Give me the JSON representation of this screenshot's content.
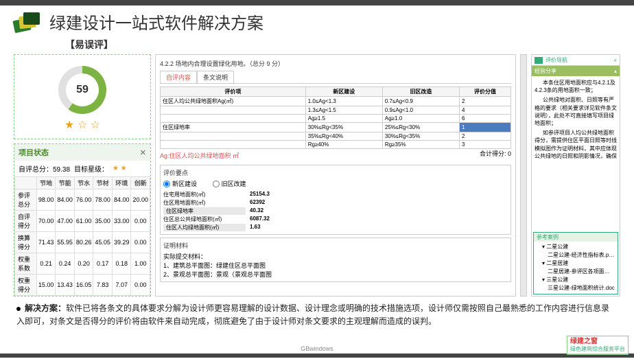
{
  "header": {
    "title": "绿建设计一站式软件解决方案",
    "sub": "【易误评】"
  },
  "score": {
    "value": "59",
    "stars": "★ ☆ ☆"
  },
  "status": {
    "title": "项目状态",
    "close": "✕",
    "self_total": "自评总分：59.38",
    "target_label": "目标星级：",
    "target_stars": "★ ★",
    "cols": [
      "节地",
      "节能",
      "节水",
      "节材",
      "环境",
      "创新"
    ],
    "rows": [
      {
        "n": "参评总分",
        "v": [
          "98.00",
          "84.00",
          "76.00",
          "78.00",
          "84.00",
          "20.00"
        ]
      },
      {
        "n": "自评得分",
        "v": [
          "70.00",
          "47.00",
          "61.00",
          "35.00",
          "33.00",
          "0.00"
        ]
      },
      {
        "n": "换算得分",
        "v": [
          "71.43",
          "55.95",
          "80.26",
          "45.05",
          "39.29",
          "0.00"
        ]
      },
      {
        "n": "权重系数",
        "v": [
          "0.21",
          "0.24",
          "0.20",
          "0.17",
          "0.18",
          "1.00"
        ]
      },
      {
        "n": "权重得分",
        "v": [
          "15.00",
          "13.43",
          "16.05",
          "7.83",
          "7.07",
          "0.00"
        ]
      }
    ]
  },
  "mid": {
    "clause": "4.2.2 场地内合理设置绿化用地。（总分 9 分）",
    "tab1": "自评内容",
    "tab2": "条文说明",
    "th": [
      "评价项",
      "新区建设",
      "旧区改造",
      "评价分值"
    ],
    "rows": [
      [
        "住区人均公共绿地面积Ag(㎡)",
        "1.0≤Ag<1.3",
        "0.7≤Ag<0.9",
        "2"
      ],
      [
        "",
        "1.3≤Ag<1.5",
        "0.9≤Ag<1.0",
        "4"
      ],
      [
        "",
        "Ag≥1.5",
        "Ag≥1.0",
        "6"
      ],
      [
        "住区绿地率",
        "30%≤Rg<35%",
        "25%≤Rg<30%",
        "1"
      ],
      [
        "",
        "35%≤Rg<40%",
        "30%≤Rg<35%",
        "2"
      ],
      [
        "",
        "Rg≥40%",
        "Rg≥35%",
        "3"
      ]
    ],
    "note": "Ag:住区人均公共绿地面积 ㎡",
    "total_label": "合计得分:",
    "total": "0",
    "sec1": "评价要点",
    "opt1": "新区建设",
    "opt2": "旧区改建",
    "gk": [
      "住宅用地面积(㎡)",
      "住区用地面积(㎡)",
      "住区绿地率",
      "住区总公共绿地面积(㎡)",
      "住区人均绿地面积(㎡)"
    ],
    "gv": [
      "25154.3",
      "62392",
      "40.32",
      "6087.32",
      "1.63"
    ],
    "sec2": "证明材料",
    "m1": "实际提交材料：",
    "m2": "1、建筑总平面图：绿建住区总平面图",
    "m3": "2、景观总平面图：景观（景观总平面图"
  },
  "right": {
    "nav": "评价导航",
    "exp": "经验分享",
    "p1": "本条住区用地面积应与4.2.1及4.2.3条的用地面积一致；",
    "p2": "公共绿地对面积、日照等有严格的要求（相关要求详见软件条文说明），此处不可直接填写项目绿地面积；",
    "p3": "如参评项目人均公共绿地面积得分，需提供住区平面日照等时线模拟图作为证明材料，其中应体现公共绿地的日照和阴影情况，确保",
    "ref": "参考案例",
    "t1": "二星公建",
    "f1": "二星公建-经济性指标表.png",
    "t2": "二星居建",
    "f2": "二星居建-参评区各项面积指标",
    "t3": "三星公建",
    "f3": "三星公建-绿地面积统计.doc"
  },
  "desc": {
    "label": "解决方案：",
    "text": "软件已将各条文的具体要求分解为设计师更容易理解的设计数据、设计理念或明确的技术措施选项，设计师仅需按照自己最熟悉的工作内容进行信息录入即可，对条文是否得分的评价将由软件来自动完成，彻底避免了由于设计师对条文要求的主观理解而造成的误判。"
  },
  "footer": {
    "brand": "GBwindows",
    "stamp1": "绿建之窗",
    "stamp2": "绿色建筑综合服务平台"
  }
}
